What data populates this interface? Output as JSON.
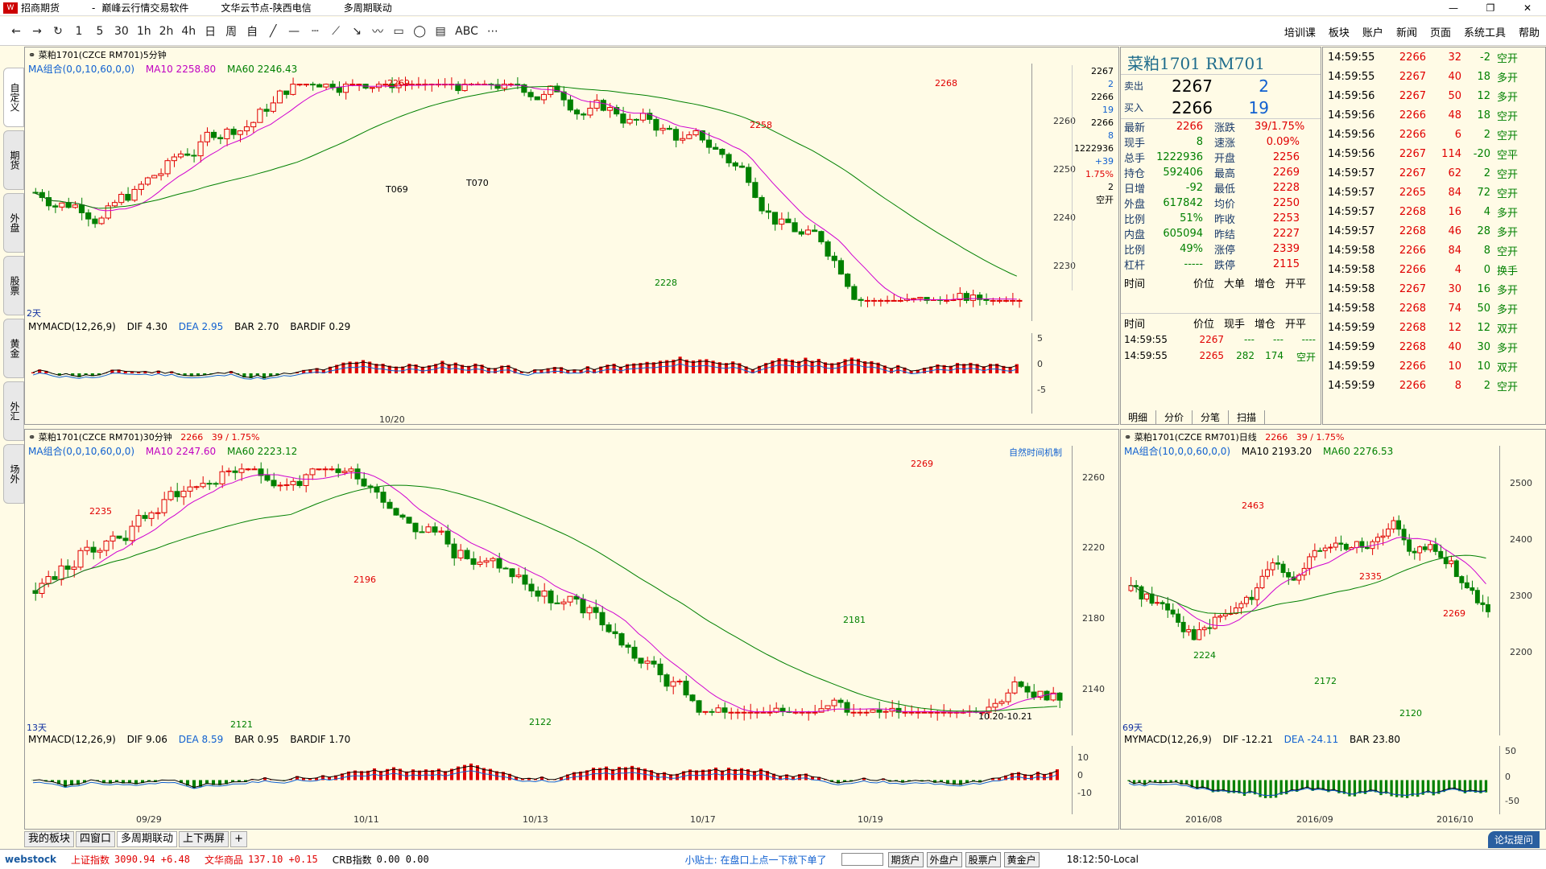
{
  "window": {
    "title_parts": [
      "招商期货",
      "-",
      "巅峰云行情交易软件",
      "文华云节点-陕西电信",
      "多周期联动"
    ],
    "controls": [
      "—",
      "❐",
      "✕"
    ]
  },
  "toolbar": {
    "tools": [
      "←",
      "→",
      "↻",
      "1",
      "5",
      "30",
      "1h",
      "2h",
      "4h",
      "日",
      "周",
      "自",
      "╱",
      "—",
      "┄",
      "⟋",
      "↘",
      "〰",
      "▭",
      "◯",
      "▤",
      "ABC",
      "⋯"
    ],
    "menu": [
      "培训课",
      "板块",
      "账户",
      "新闻",
      "页面",
      "系统工具",
      "帮助"
    ]
  },
  "left_tabs": [
    "自定义",
    "期货",
    "外盘",
    "股票",
    "黄金",
    "外汇",
    "场外"
  ],
  "chart1": {
    "header": "菜粕1701(CZCE RM701)5分钟",
    "ma_label": "MA组合(0,0,10,60,0,0)",
    "ma10": "MA10 2258.80",
    "ma60": "MA60 2246.43",
    "annotations": [
      "2269",
      "2268",
      "2258",
      "2228",
      "T069",
      "T070"
    ],
    "period_label": "2天",
    "date_label": "10/20",
    "y_ticks": [
      "2260",
      "2250",
      "2240",
      "2230"
    ],
    "macd": {
      "name": "MYMACD(12,26,9)",
      "dif": "DIF 4.30",
      "dea": "DEA 2.95",
      "bar": "BAR 2.70",
      "bardif": "BARDIF 0.29",
      "ticks": [
        "5",
        "0",
        "-5"
      ]
    },
    "inset": [
      "2267",
      "2",
      "2266",
      "19",
      "2266",
      "8",
      "1222936",
      "+39",
      "1.75%",
      "2",
      "空开"
    ]
  },
  "quote": {
    "title": "菜粕1701  RM701",
    "sell": {
      "label": "卖出",
      "price": "2267",
      "vol": "2"
    },
    "buy": {
      "label": "买入",
      "price": "2266",
      "vol": "19"
    },
    "rows": [
      {
        "l": "最新",
        "v": "2266",
        "l2": "涨跌",
        "v2": "39/1.75%"
      },
      {
        "l": "现手",
        "v": "8",
        "l2": "速涨",
        "v2": "0.09%"
      },
      {
        "l": "总手",
        "v": "1222936",
        "l2": "开盘",
        "v2": "2256"
      },
      {
        "l": "持仓",
        "v": "592406",
        "l2": "最高",
        "v2": "2269"
      },
      {
        "l": "日增",
        "v": "-92",
        "l2": "最低",
        "v2": "2228"
      },
      {
        "l": "外盘",
        "v": "617842",
        "l2": "均价",
        "v2": "2250"
      },
      {
        "l": "比例",
        "v": "51%",
        "l2": "昨收",
        "v2": "2253"
      },
      {
        "l": "内盘",
        "v": "605094",
        "l2": "昨结",
        "v2": "2227"
      },
      {
        "l": "比例",
        "v": "49%",
        "l2": "涨停",
        "v2": "2339"
      },
      {
        "l": "杠杆",
        "v": "-----",
        "l2": "跌停",
        "v2": "2115"
      }
    ],
    "head1": [
      "时间",
      "价位",
      "大单",
      "增仓",
      "开平"
    ],
    "head2": [
      "时间",
      "价位",
      "现手",
      "增仓",
      "开平"
    ],
    "detail": [
      {
        "t": "14:59:55",
        "p": "2267",
        "q": "---",
        "c": "---",
        "k": "----"
      },
      {
        "t": "14:59:55",
        "p": "2265",
        "q": "282",
        "c": "174",
        "k": "空开"
      }
    ],
    "subtabs": [
      "明细",
      "分价",
      "分笔",
      "扫描"
    ]
  },
  "trades": [
    {
      "t": "14:59:55",
      "p": "2266",
      "q": "32",
      "c": "-2",
      "k": "空开"
    },
    {
      "t": "14:59:55",
      "p": "2267",
      "q": "40",
      "c": "18",
      "k": "多开"
    },
    {
      "t": "14:59:56",
      "p": "2267",
      "q": "50",
      "c": "12",
      "k": "多开"
    },
    {
      "t": "14:59:56",
      "p": "2266",
      "q": "48",
      "c": "18",
      "k": "空开"
    },
    {
      "t": "14:59:56",
      "p": "2266",
      "q": "6",
      "c": "2",
      "k": "空开"
    },
    {
      "t": "14:59:56",
      "p": "2267",
      "q": "114",
      "c": "-20",
      "k": "空平"
    },
    {
      "t": "14:59:57",
      "p": "2267",
      "q": "62",
      "c": "2",
      "k": "空开"
    },
    {
      "t": "14:59:57",
      "p": "2265",
      "q": "84",
      "c": "72",
      "k": "空开"
    },
    {
      "t": "14:59:57",
      "p": "2268",
      "q": "16",
      "c": "4",
      "k": "多开"
    },
    {
      "t": "14:59:57",
      "p": "2268",
      "q": "46",
      "c": "28",
      "k": "多开"
    },
    {
      "t": "14:59:58",
      "p": "2266",
      "q": "84",
      "c": "8",
      "k": "空开"
    },
    {
      "t": "14:59:58",
      "p": "2266",
      "q": "4",
      "c": "0",
      "k": "换手"
    },
    {
      "t": "14:59:58",
      "p": "2267",
      "q": "30",
      "c": "16",
      "k": "多开"
    },
    {
      "t": "14:59:58",
      "p": "2268",
      "q": "74",
      "c": "50",
      "k": "多开"
    },
    {
      "t": "14:59:59",
      "p": "2268",
      "q": "12",
      "c": "12",
      "k": "双开"
    },
    {
      "t": "14:59:59",
      "p": "2268",
      "q": "40",
      "c": "30",
      "k": "多开"
    },
    {
      "t": "14:59:59",
      "p": "2266",
      "q": "10",
      "c": "10",
      "k": "双开"
    },
    {
      "t": "14:59:59",
      "p": "2266",
      "q": "8",
      "c": "2",
      "k": "空开"
    }
  ],
  "chart2": {
    "header": "菜粕1701(CZCE RM701)30分钟",
    "hdr_price": "2266",
    "hdr_change": "39 / 1.75%",
    "ma_label": "MA组合(0,0,10,60,0,0)",
    "ma10": "MA10 2247.60",
    "ma60": "MA60 2223.12",
    "annotations": [
      "2235",
      "2196",
      "2269",
      "2181",
      "2121",
      "2122",
      "自然时间机制",
      "10.20-10.21"
    ],
    "period_label": "13天",
    "y_ticks": [
      "2260",
      "2220",
      "2180",
      "2140"
    ],
    "x_ticks": [
      "09/29",
      "10/11",
      "10/13",
      "10/17",
      "10/19"
    ],
    "macd": {
      "name": "MYMACD(12,26,9)",
      "dif": "DIF 9.06",
      "dea": "DEA 8.59",
      "bar": "BAR 0.95",
      "bardif": "BARDIF 1.70",
      "ticks": [
        "10",
        "0",
        "-10"
      ]
    }
  },
  "chart3": {
    "header": "菜粕1701(CZCE RM701)日线",
    "hdr_price": "2266",
    "hdr_change": "39 / 1.75%",
    "ma_label": "MA组合(10,0,0,60,0,0)",
    "ma10": "MA10 2193.20",
    "ma60": "MA60 2276.53",
    "annotations": [
      "2463",
      "2335",
      "2269",
      "2224",
      "2172",
      "2120"
    ],
    "period_label": "69天",
    "y_ticks": [
      "2500",
      "2400",
      "2300",
      "2200"
    ],
    "x_ticks": [
      "2016/08",
      "2016/09",
      "2016/10"
    ],
    "macd": {
      "name": "MYMACD(12,26,9)",
      "dif": "DIF -12.21",
      "dea": "DEA -24.11",
      "bar": "BAR 23.80",
      "ticks": [
        "50",
        "0",
        "-50"
      ]
    }
  },
  "bottom_tabs": [
    "我的板块",
    "四窗口",
    "多周期联动",
    "上下两屏",
    "+"
  ],
  "forum_button": "论坛提问",
  "status": {
    "brand": "webstock",
    "sh_label": "上证指数",
    "sh_value": "3090.94 +6.48",
    "wh_label": "文华商品",
    "wh_value": "137.10 +0.15",
    "crb_label": "CRB指数",
    "crb_value": "0.00 0.00",
    "tip": "小贴士: 在盘口上点一下就下单了",
    "accounts": [
      "期货户",
      "外盘户",
      "股票户",
      "黄金户"
    ],
    "clock": "18:12:50-Local"
  }
}
